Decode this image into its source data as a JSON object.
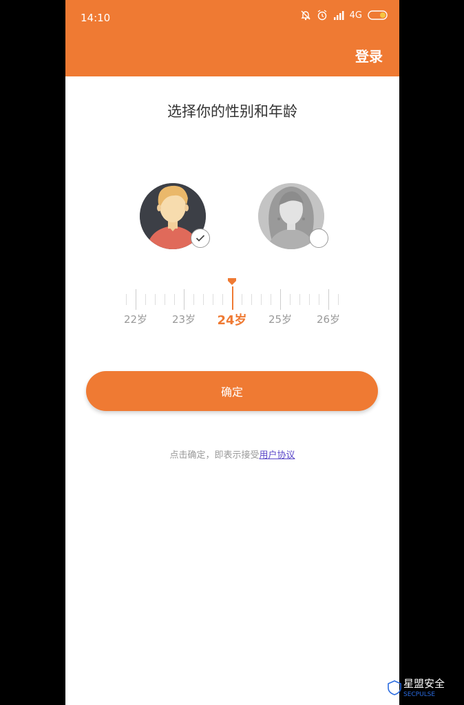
{
  "status": {
    "time": "14:10",
    "network": "4G"
  },
  "header": {
    "login_label": "登录"
  },
  "page": {
    "title": "选择你的性别和年龄"
  },
  "gender": {
    "selected": "male",
    "options": [
      "male",
      "female"
    ]
  },
  "age_ruler": {
    "labels": [
      "22岁",
      "23岁",
      "24岁",
      "25岁",
      "26岁"
    ],
    "selected_index": 2
  },
  "confirm": {
    "label": "确定"
  },
  "terms": {
    "prefix": "点击确定，即表示接受",
    "link": "用户协议"
  },
  "watermark": {
    "text": "星盟安全",
    "sub": "SECPULSE"
  },
  "colors": {
    "accent": "#ef7a33",
    "link": "#5a46c8"
  },
  "icons": [
    "mute-bell-icon",
    "alarm-icon",
    "signal-icon",
    "battery-icon",
    "checkmark-icon",
    "male-avatar-icon",
    "female-avatar-icon",
    "age-pointer-icon"
  ]
}
